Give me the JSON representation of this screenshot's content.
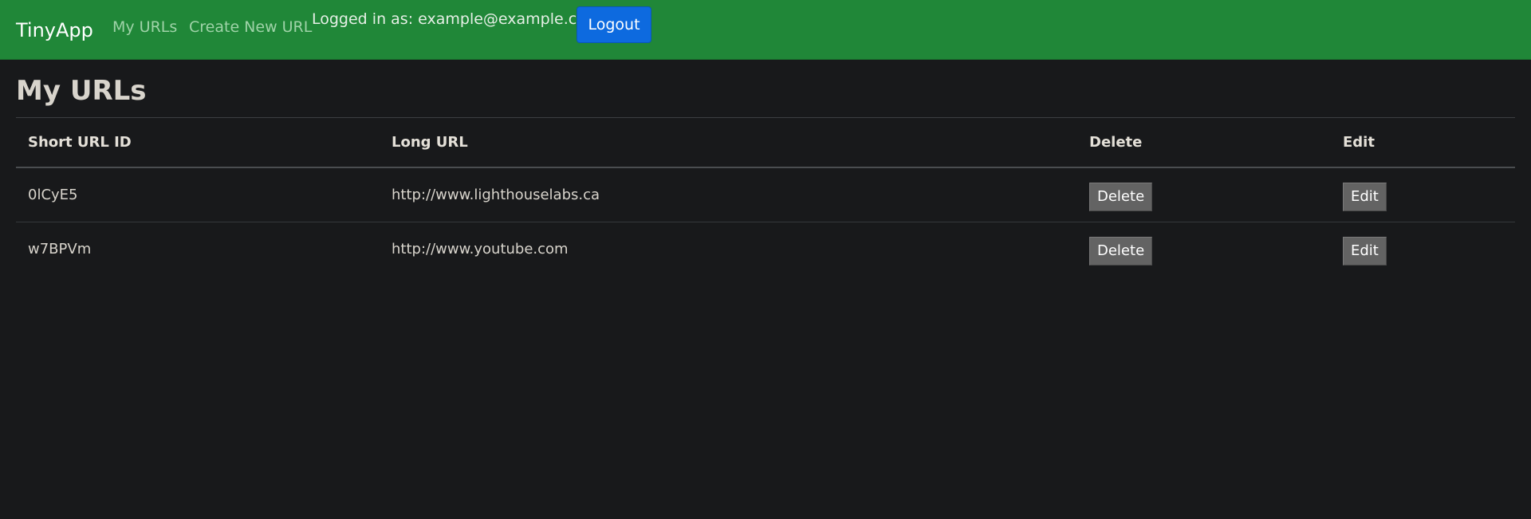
{
  "navbar": {
    "brand": "TinyApp",
    "links": [
      {
        "label": "My URLs"
      },
      {
        "label": "Create New URL"
      }
    ],
    "logged_in_text": "Logged in as: example@example.com",
    "logout_label": "Logout",
    "background_color": "#208738"
  },
  "main": {
    "title": "My URLs",
    "table": {
      "headers": {
        "short_id": "Short URL ID",
        "long_url": "Long URL",
        "delete": "Delete",
        "edit": "Edit"
      },
      "rows": [
        {
          "short_id": "0lCyE5",
          "long_url": "http://www.lighthouselabs.ca",
          "delete_label": "Delete",
          "edit_label": "Edit"
        },
        {
          "short_id": "w7BPVm",
          "long_url": "http://www.youtube.com",
          "delete_label": "Delete",
          "edit_label": "Edit"
        }
      ]
    }
  }
}
